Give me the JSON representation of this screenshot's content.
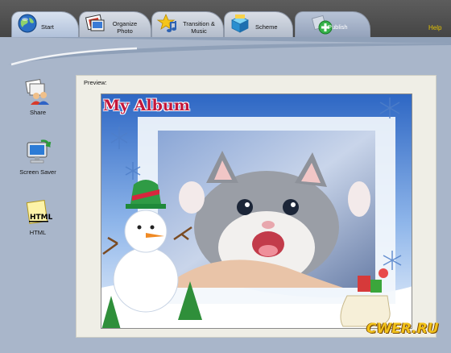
{
  "tabs": [
    {
      "label": "Start",
      "icon": "globe-icon"
    },
    {
      "label": "Organize Photo",
      "icon": "photo-icon"
    },
    {
      "label": "Transition & Music",
      "icon": "music-star-icon"
    },
    {
      "label": "Scheme",
      "icon": "scheme-icon"
    },
    {
      "label": "Publish",
      "icon": "publish-icon"
    }
  ],
  "help": "Help",
  "sidebar": {
    "items": [
      {
        "label": "Share",
        "icon": "share-icon"
      },
      {
        "label": "Screen Saver",
        "icon": "screen-saver-icon"
      },
      {
        "label": "HTML",
        "icon": "html-icon"
      }
    ]
  },
  "preview": {
    "label": "Preview:",
    "album_title": "My Album"
  },
  "watermark": "CWER.RU",
  "colors": {
    "topbar": "#4f4f4f",
    "background": "#a9b6ca",
    "panel": "#efeee6",
    "album_title": "#c2163a",
    "help": "#e5c400",
    "watermark": "#f2c21a"
  }
}
